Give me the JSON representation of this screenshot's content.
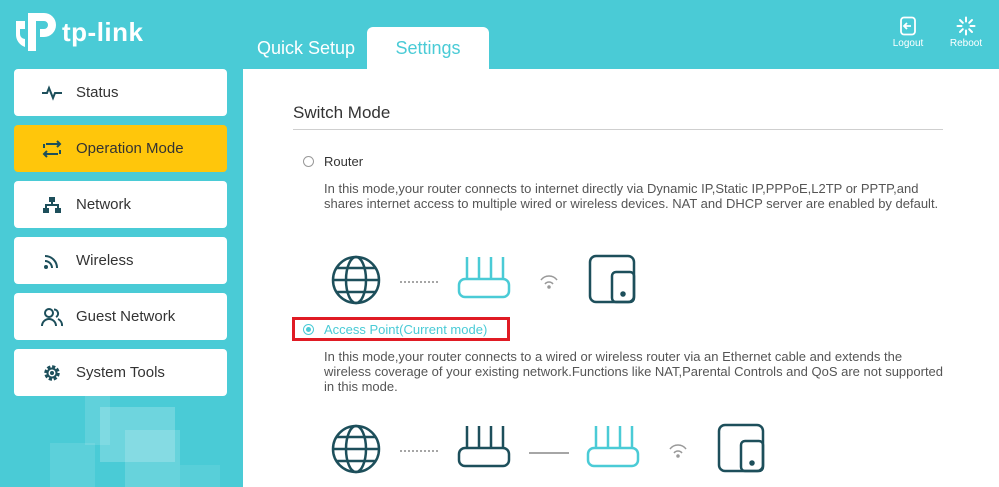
{
  "brand": {
    "logo_text": "tp-link"
  },
  "tabs": [
    {
      "label": "Quick Setup"
    },
    {
      "label": "Settings"
    }
  ],
  "header_buttons": {
    "logout": "Logout",
    "reboot": "Reboot"
  },
  "sidebar": {
    "items": [
      {
        "label": "Status",
        "icon": "pulse-icon"
      },
      {
        "label": "Operation Mode",
        "icon": "switch-arrows-icon",
        "active": true
      },
      {
        "label": "Network",
        "icon": "network-tree-icon"
      },
      {
        "label": "Wireless",
        "icon": "wifi-icon"
      },
      {
        "label": "Guest Network",
        "icon": "guests-icon"
      },
      {
        "label": "System Tools",
        "icon": "gear-icon"
      }
    ]
  },
  "main": {
    "title": "Switch Mode",
    "options": [
      {
        "label": "Router",
        "checked": false,
        "description": "In this mode,your router connects to internet directly via Dynamic IP,Static IP,PPPoE,L2TP or PPTP,and shares internet access to multiple wired or wireless devices. NAT and DHCP server are enabled by default."
      },
      {
        "label": "Access Point(Current mode)",
        "checked": true,
        "description": "In this mode,your router connects to a wired or wireless router via an Ethernet cable and extends the wireless coverage of your existing network.Functions like NAT,Parental Controls and QoS are not supported in this mode."
      }
    ]
  },
  "colors": {
    "accent": "#4acbd6",
    "active_item": "#ffc60b",
    "highlight": "#e01b24",
    "dark_icon": "#1d4f5b"
  }
}
